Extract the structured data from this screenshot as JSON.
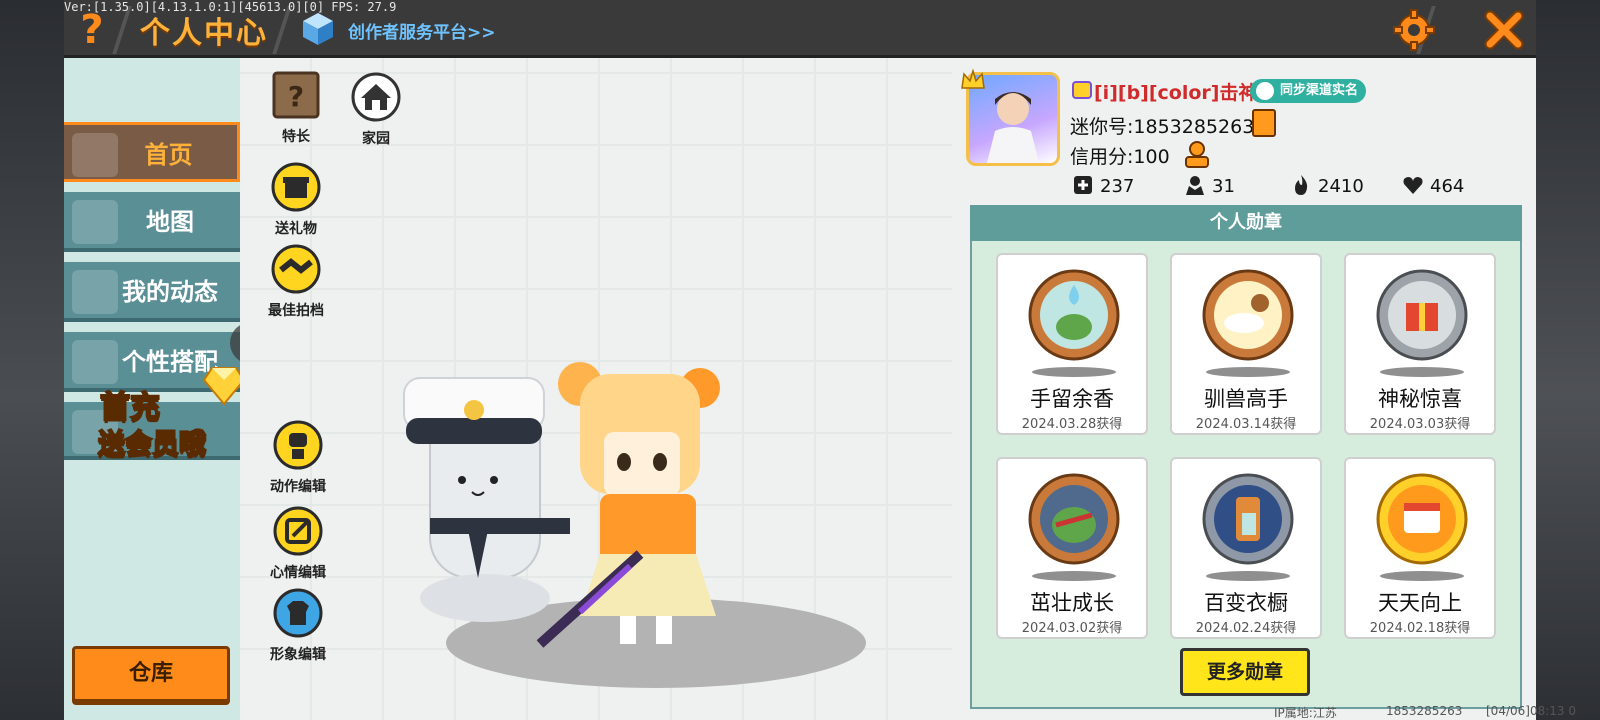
{
  "version_text": "Ver:[1.35.0][4.13.1.0:1][45613.0][0] FPS: 27.9",
  "header": {
    "help_label": "?",
    "title": "个人中心",
    "creator_link": "创作者服务平台>>"
  },
  "sidenav": {
    "items": [
      {
        "label": "首页",
        "active": true
      },
      {
        "label": "地图",
        "active": false
      },
      {
        "label": "我的动态",
        "active": false
      },
      {
        "label": "个性搭配",
        "active": false
      }
    ],
    "warehouse_label": "仓库"
  },
  "promo": {
    "line1": "首充",
    "line2": "送会员哦"
  },
  "actions": {
    "talent": "特长",
    "home": "家园",
    "gift": "送礼物",
    "partner": "最佳拍档",
    "motion_edit": "动作编辑",
    "mood_edit": "心情编辑",
    "look_edit": "形象编辑"
  },
  "profile": {
    "nickname": "[i][b][color]击神",
    "realname_badge": "同步渠道实名",
    "mini_id": "迷你号:1853285263",
    "credit": "信用分:100",
    "stats": {
      "add": "237",
      "fans": "31",
      "hot": "2410",
      "likes": "464"
    }
  },
  "medals": {
    "title": "个人勋章",
    "items": [
      {
        "name": "手留余香",
        "date": "2024.03.28获得"
      },
      {
        "name": "驯兽高手",
        "date": "2024.03.14获得"
      },
      {
        "name": "神秘惊喜",
        "date": "2024.03.03获得"
      },
      {
        "name": "茁壮成长",
        "date": "2024.03.02获得"
      },
      {
        "name": "百变衣橱",
        "date": "2024.02.24获得"
      },
      {
        "name": "天天向上",
        "date": "2024.02.18获得"
      }
    ],
    "more_label": "更多勋章"
  },
  "footer": {
    "ip": "IP属地:江苏",
    "uid": "1853285263",
    "time": "[04/06]08:13 0"
  },
  "colors": {
    "accent_orange": "#ff8c1a",
    "title_gold": "#ffb13a",
    "nav_teal": "#5a8f96",
    "medal_header": "#5e9d9a",
    "nickname_red": "#d12a2a"
  }
}
